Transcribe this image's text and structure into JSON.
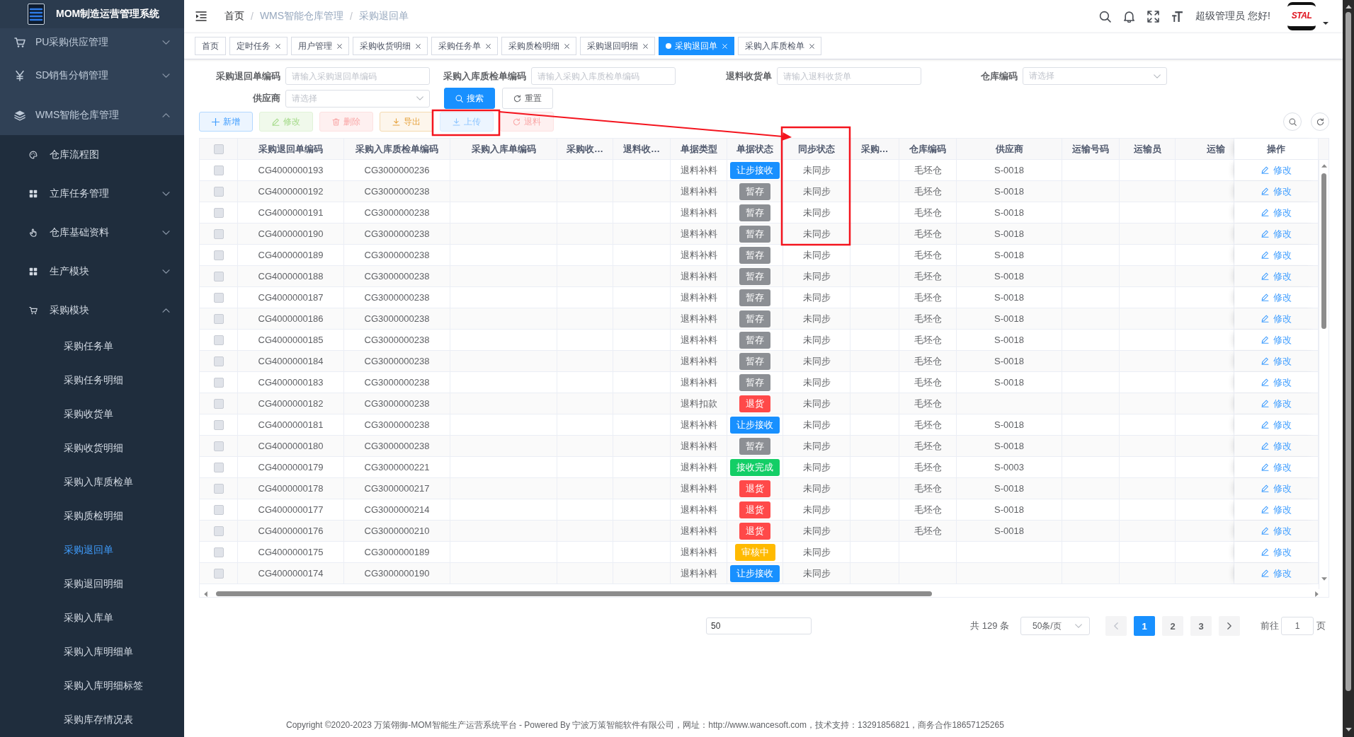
{
  "sidebar": {
    "title": "MOM制造运营管理系统",
    "items": [
      {
        "label": "PU采购供应管理",
        "expanded": false
      },
      {
        "label": "SD销售分销管理",
        "expanded": false
      },
      {
        "label": "WMS智能仓库管理",
        "expanded": true,
        "children": [
          {
            "label": "仓库流程图",
            "selected": false
          },
          {
            "label": "立库任务管理",
            "expanded": false
          },
          {
            "label": "仓库基础资料",
            "expanded": false
          },
          {
            "label": "生产模块",
            "expanded": false
          },
          {
            "label": "采购模块",
            "expanded": true,
            "children": [
              {
                "label": "采购任务单",
                "selected": false
              },
              {
                "label": "采购任务明细",
                "selected": false
              },
              {
                "label": "采购收货单",
                "selected": false
              },
              {
                "label": "采购收货明细",
                "selected": false
              },
              {
                "label": "采购入库质检单",
                "selected": false
              },
              {
                "label": "采购质检明细",
                "selected": false
              },
              {
                "label": "采购退回单",
                "selected": true
              },
              {
                "label": "采购退回明细",
                "selected": false
              },
              {
                "label": "采购入库单",
                "selected": false
              },
              {
                "label": "采购入库明细单",
                "selected": false
              },
              {
                "label": "采购入库明细标签",
                "selected": false
              },
              {
                "label": "采购库存情况表",
                "selected": false
              }
            ]
          }
        ]
      }
    ]
  },
  "header": {
    "breadcrumb": [
      {
        "label": "首页",
        "link": true
      },
      {
        "separator": "/",
        "label": "WMS智能仓库管理",
        "link": false
      },
      {
        "separator": "/",
        "label": "采购退回单",
        "link": false
      }
    ],
    "greeting": "超级管理员 您好!",
    "logo_text": "STAL"
  },
  "tabs": [
    {
      "label": "首页",
      "selected": false,
      "closable": false
    },
    {
      "label": "定时任务",
      "selected": false,
      "closable": true
    },
    {
      "label": "用户管理",
      "selected": false,
      "closable": true
    },
    {
      "label": "采购收货明细",
      "selected": false,
      "closable": true
    },
    {
      "label": "采购任务单",
      "selected": false,
      "closable": true
    },
    {
      "label": "采购质检明细",
      "selected": false,
      "closable": true
    },
    {
      "label": "采购退回明细",
      "selected": false,
      "closable": true
    },
    {
      "label": "采购退回单",
      "selected": true,
      "closable": true
    },
    {
      "label": "采购入库质检单",
      "selected": false,
      "closable": true
    }
  ],
  "filter": {
    "fields": [
      {
        "label": "采购退回单编码",
        "placeholder": "请输入采购退回单编码",
        "kind": "input"
      },
      {
        "label": "采购入库质检单编码",
        "placeholder": "请输入采购入库质检单编码",
        "kind": "input"
      },
      {
        "label": "退料收货单",
        "placeholder": "请输入退料收货单",
        "kind": "input"
      },
      {
        "label": "仓库编码",
        "placeholder": "请选择",
        "kind": "select"
      },
      {
        "label": "供应商",
        "placeholder": "请选择",
        "kind": "select"
      }
    ],
    "buttons": [
      {
        "label": "搜索",
        "kind": "search"
      },
      {
        "label": "重置",
        "kind": "reset"
      }
    ]
  },
  "toolbar": {
    "buttons": [
      {
        "label": "新增",
        "kind": "add",
        "disabled": false
      },
      {
        "label": "修改",
        "kind": "edit",
        "disabled": true
      },
      {
        "label": "删除",
        "kind": "delete",
        "disabled": true
      },
      {
        "label": "导出",
        "kind": "export",
        "disabled": false
      },
      {
        "label": "上传",
        "kind": "upload",
        "disabled": true
      },
      {
        "label": "退料",
        "kind": "return",
        "disabled": true
      }
    ]
  },
  "table": {
    "select_all_checked": false,
    "columns": [
      "采购退回单编码",
      "采购入库质检单编码",
      "采购入库单编码",
      "采购收…",
      "退料收…",
      "单据类型",
      "单据状态",
      "同步状态",
      "采购…",
      "仓库编码",
      "供应商",
      "运输号码",
      "运输员",
      "运输",
      "操作"
    ],
    "rows": [
      {
        "checked": false,
        "return_code": "CG4000000193",
        "qc_code": "CG3000000236",
        "type": "退料补料",
        "status": {
          "label": "让步接收",
          "color": "#1890ff"
        },
        "sync": "未同步",
        "warehouse": "毛坯仓",
        "supplier": "S-0018",
        "action": "修改"
      },
      {
        "checked": false,
        "return_code": "CG4000000192",
        "qc_code": "CG3000000238",
        "type": "退料补料",
        "status": {
          "label": "暂存",
          "color": "#8c8f94"
        },
        "sync": "未同步",
        "warehouse": "毛坯仓",
        "supplier": "S-0018",
        "action": "修改"
      },
      {
        "checked": false,
        "return_code": "CG4000000191",
        "qc_code": "CG3000000238",
        "type": "退料补料",
        "status": {
          "label": "暂存",
          "color": "#8c8f94"
        },
        "sync": "未同步",
        "warehouse": "毛坯仓",
        "supplier": "S-0018",
        "action": "修改"
      },
      {
        "checked": false,
        "return_code": "CG4000000190",
        "qc_code": "CG3000000238",
        "type": "退料补料",
        "status": {
          "label": "暂存",
          "color": "#8c8f94"
        },
        "sync": "未同步",
        "warehouse": "毛坯仓",
        "supplier": "S-0018",
        "action": "修改"
      },
      {
        "checked": false,
        "return_code": "CG4000000189",
        "qc_code": "CG3000000238",
        "type": "退料补料",
        "status": {
          "label": "暂存",
          "color": "#8c8f94"
        },
        "sync": "未同步",
        "warehouse": "毛坯仓",
        "supplier": "S-0018",
        "action": "修改"
      },
      {
        "checked": false,
        "return_code": "CG4000000188",
        "qc_code": "CG3000000238",
        "type": "退料补料",
        "status": {
          "label": "暂存",
          "color": "#8c8f94"
        },
        "sync": "未同步",
        "warehouse": "毛坯仓",
        "supplier": "S-0018",
        "action": "修改"
      },
      {
        "checked": false,
        "return_code": "CG4000000187",
        "qc_code": "CG3000000238",
        "type": "退料补料",
        "status": {
          "label": "暂存",
          "color": "#8c8f94"
        },
        "sync": "未同步",
        "warehouse": "毛坯仓",
        "supplier": "S-0018",
        "action": "修改"
      },
      {
        "checked": false,
        "return_code": "CG4000000186",
        "qc_code": "CG3000000238",
        "type": "退料补料",
        "status": {
          "label": "暂存",
          "color": "#8c8f94"
        },
        "sync": "未同步",
        "warehouse": "毛坯仓",
        "supplier": "S-0018",
        "action": "修改"
      },
      {
        "checked": false,
        "return_code": "CG4000000185",
        "qc_code": "CG3000000238",
        "type": "退料补料",
        "status": {
          "label": "暂存",
          "color": "#8c8f94"
        },
        "sync": "未同步",
        "warehouse": "毛坯仓",
        "supplier": "S-0018",
        "action": "修改"
      },
      {
        "checked": false,
        "return_code": "CG4000000184",
        "qc_code": "CG3000000238",
        "type": "退料补料",
        "status": {
          "label": "暂存",
          "color": "#8c8f94"
        },
        "sync": "未同步",
        "warehouse": "毛坯仓",
        "supplier": "S-0018",
        "action": "修改"
      },
      {
        "checked": false,
        "return_code": "CG4000000183",
        "qc_code": "CG3000000238",
        "type": "退料补料",
        "status": {
          "label": "暂存",
          "color": "#8c8f94"
        },
        "sync": "未同步",
        "warehouse": "毛坯仓",
        "supplier": "S-0018",
        "action": "修改"
      },
      {
        "checked": false,
        "return_code": "CG4000000182",
        "qc_code": "CG3000000238",
        "type": "退料扣款",
        "status": {
          "label": "退货",
          "color": "#ff4949"
        },
        "sync": "未同步",
        "warehouse": "毛坯仓",
        "action": "修改"
      },
      {
        "checked": false,
        "return_code": "CG4000000181",
        "qc_code": "CG3000000238",
        "type": "退料补料",
        "status": {
          "label": "让步接收",
          "color": "#1890ff"
        },
        "sync": "未同步",
        "warehouse": "毛坯仓",
        "supplier": "S-0018",
        "action": "修改"
      },
      {
        "checked": false,
        "return_code": "CG4000000180",
        "qc_code": "CG3000000238",
        "type": "退料补料",
        "status": {
          "label": "暂存",
          "color": "#8c8f94"
        },
        "sync": "未同步",
        "warehouse": "毛坯仓",
        "supplier": "S-0018",
        "action": "修改"
      },
      {
        "checked": false,
        "return_code": "CG4000000179",
        "qc_code": "CG3000000221",
        "type": "退料补料",
        "status": {
          "label": "接收完成",
          "color": "#13ce66"
        },
        "sync": "未同步",
        "warehouse": "毛坯仓",
        "supplier": "S-0003",
        "action": "修改"
      },
      {
        "checked": false,
        "return_code": "CG4000000178",
        "qc_code": "CG3000000217",
        "type": "退料补料",
        "status": {
          "label": "退货",
          "color": "#ff4949"
        },
        "sync": "未同步",
        "warehouse": "毛坯仓",
        "supplier": "S-0018",
        "action": "修改"
      },
      {
        "checked": false,
        "return_code": "CG4000000177",
        "qc_code": "CG3000000214",
        "type": "退料补料",
        "status": {
          "label": "退货",
          "color": "#ff4949"
        },
        "sync": "未同步",
        "warehouse": "毛坯仓",
        "supplier": "S-0018",
        "action": "修改"
      },
      {
        "checked": false,
        "return_code": "CG4000000176",
        "qc_code": "CG3000000210",
        "type": "退料补料",
        "status": {
          "label": "退货",
          "color": "#ff4949"
        },
        "sync": "未同步",
        "warehouse": "毛坯仓",
        "supplier": "S-0018",
        "action": "修改"
      },
      {
        "checked": false,
        "return_code": "CG4000000175",
        "qc_code": "CG3000000189",
        "type": "退料补料",
        "status": {
          "label": "审核中",
          "color": "#ffba00"
        },
        "sync": "未同步",
        "action": "修改"
      },
      {
        "checked": false,
        "return_code": "CG4000000174",
        "qc_code": "CG3000000190",
        "type": "退料补料",
        "status": {
          "label": "让步接收",
          "color": "#1890ff"
        },
        "sync": "未同步",
        "action": "修改"
      }
    ]
  },
  "pagination": {
    "jump_value": "50",
    "total": "共 129 条",
    "page_size": "50条/页",
    "prev_disabled": true,
    "next_disabled": false,
    "pages": [
      {
        "label": "1",
        "selected": true
      },
      {
        "label": "2",
        "selected": false
      },
      {
        "label": "3",
        "selected": false
      }
    ],
    "goto_label": "前往",
    "goto_value": "1",
    "goto_suffix": "页"
  },
  "footer": {
    "text": "Copyright ©2020-2023 万策翎御-MOM智能生产运营系统平台 - Powered By 宁波万策智能软件有限公司，网址：http://www.wancesoft.com，技术支持：13291856821，商务合作18657125265"
  },
  "annotations": [
    {
      "kind": "box"
    },
    {
      "kind": "arrow"
    },
    {
      "kind": "box"
    }
  ]
}
